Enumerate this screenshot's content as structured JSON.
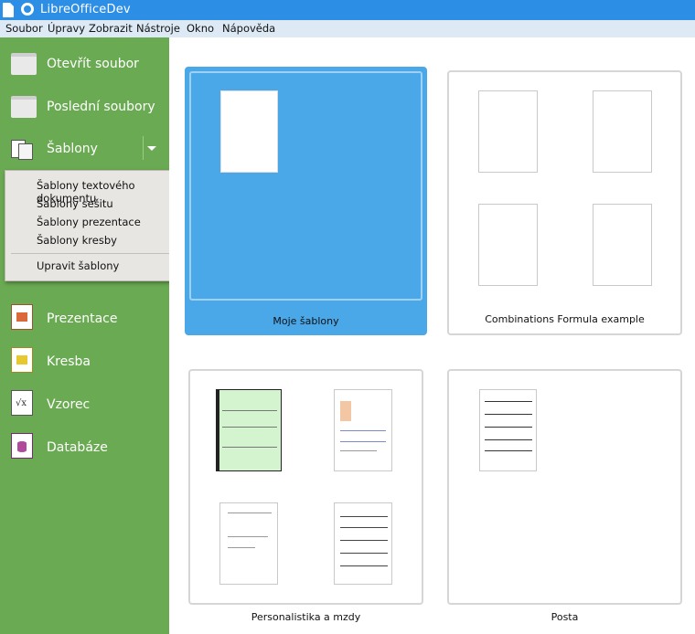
{
  "window": {
    "title": "LibreOfficeDev"
  },
  "menu": [
    "Soubor",
    "Úpravy",
    "Zobrazit",
    "Nástroje",
    "Okno",
    "Nápověda"
  ],
  "sidebar": {
    "items": [
      {
        "label": "Otevřít soubor",
        "icon": "folder-icon"
      },
      {
        "label": "Poslední soubory",
        "icon": "folder-icon"
      },
      {
        "label": "Šablony",
        "icon": "templates-icon"
      },
      {
        "label": "Prezentace",
        "icon": "presentation-icon"
      },
      {
        "label": "Kresba",
        "icon": "drawing-icon"
      },
      {
        "label": "Vzorec",
        "icon": "formula-icon"
      },
      {
        "label": "Databáze",
        "icon": "database-icon"
      }
    ]
  },
  "templates_menu": {
    "items": [
      "Šablony textového dokumentu",
      "Šablony sešitu",
      "Šablony prezentace",
      "Šablony kresby"
    ],
    "manage": "Upravit šablony"
  },
  "folders": [
    {
      "caption": "Moje šablony",
      "selected": true
    },
    {
      "caption": "Combinations Formula example",
      "selected": false
    },
    {
      "caption": "Personalistika a mzdy",
      "selected": false
    },
    {
      "caption": "Posta",
      "selected": false
    }
  ],
  "colors": {
    "sidebar": "#6aaa52",
    "titlebar": "#2d8ee6",
    "selection": "#4aa7e8"
  }
}
